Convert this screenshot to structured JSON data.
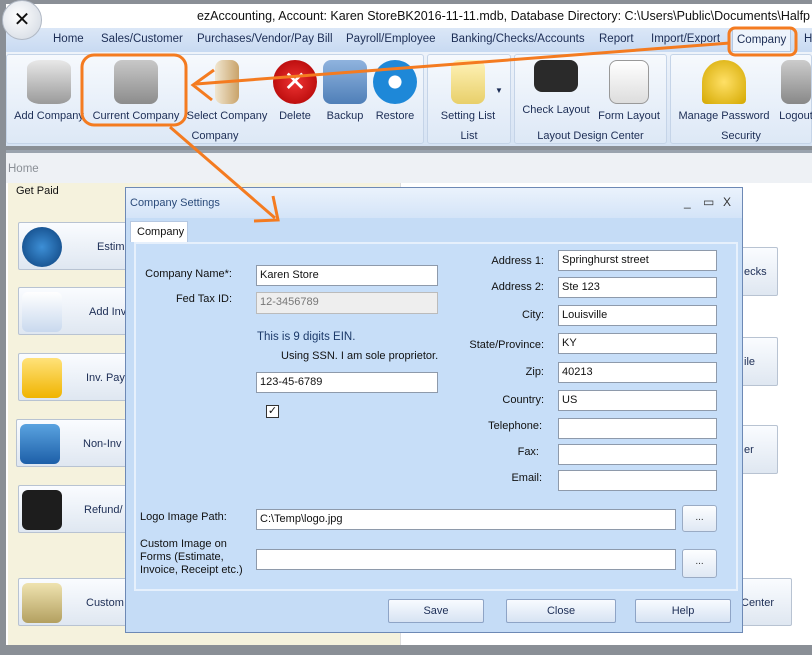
{
  "window": {
    "title": "ezAccounting, Account: Karen StoreBK2016-11-11.mdb, Database Directory: C:\\Users\\Public\\Documents\\Halfp"
  },
  "menu": [
    "Home",
    "Sales/Customer",
    "Purchases/Vendor/Pay Bill",
    "Payroll/Employee",
    "Banking/Checks/Accounts",
    "Report",
    "Import/Export",
    "Company",
    "H"
  ],
  "ribbon": {
    "groups": [
      {
        "label": "Company"
      },
      {
        "label": "List"
      },
      {
        "label": "Layout Design Center"
      },
      {
        "label": "Security"
      }
    ],
    "buttons": [
      "Add Company",
      "Current Company",
      "Select Company",
      "Delete",
      "Backup",
      "Restore",
      "Setting List",
      "Check  Layout",
      "Form Layout",
      "Manage Password",
      "Logout"
    ]
  },
  "breadcrumb": "Home",
  "background": {
    "section": "Get Paid",
    "tiles": [
      "Estim",
      "Add Inv",
      "Inv. Paym",
      "Non-Inv",
      "Refund/",
      "Custom"
    ],
    "right_tiles": [
      "ecks",
      "ile",
      "er",
      "Center"
    ]
  },
  "dialog": {
    "title": "Company Settings",
    "tab": "Company",
    "labels": {
      "company_name": "Company Name*:",
      "fed_tax_id": "Fed Tax ID:",
      "ein_note": "This is 9 digits EIN.",
      "ssn_checkbox": "Using SSN. I am sole proprietor.",
      "address1": "Address 1:",
      "address2": "Address 2:",
      "city": "City:",
      "state": "State/Province:",
      "zip": "Zip:",
      "country": "Country:",
      "telephone": "Telephone:",
      "fax": "Fax:",
      "email": "Email:",
      "logo_path": "Logo Image Path:",
      "custom_image": "Custom Image on Forms (Estimate, Invoice, Receipt etc.)"
    },
    "values": {
      "company_name": "Karen Store",
      "fed_tax_id": "12-3456789",
      "ssn_checked": true,
      "ssn": "123-45-6789",
      "address1": "Springhurst street",
      "address2": "Ste 123",
      "city": "Louisville",
      "state": "KY",
      "zip": "40213",
      "country": "US",
      "telephone": "",
      "fax": "",
      "email": "",
      "logo_path": "C:\\Temp\\logo.jpg",
      "custom_image": ""
    },
    "browse_label": "...",
    "buttons": {
      "save": "Save",
      "close": "Close",
      "help": "Help"
    }
  },
  "colors": {
    "annotation": "#f47b20",
    "dialog_bg": "#c5dcf6"
  }
}
